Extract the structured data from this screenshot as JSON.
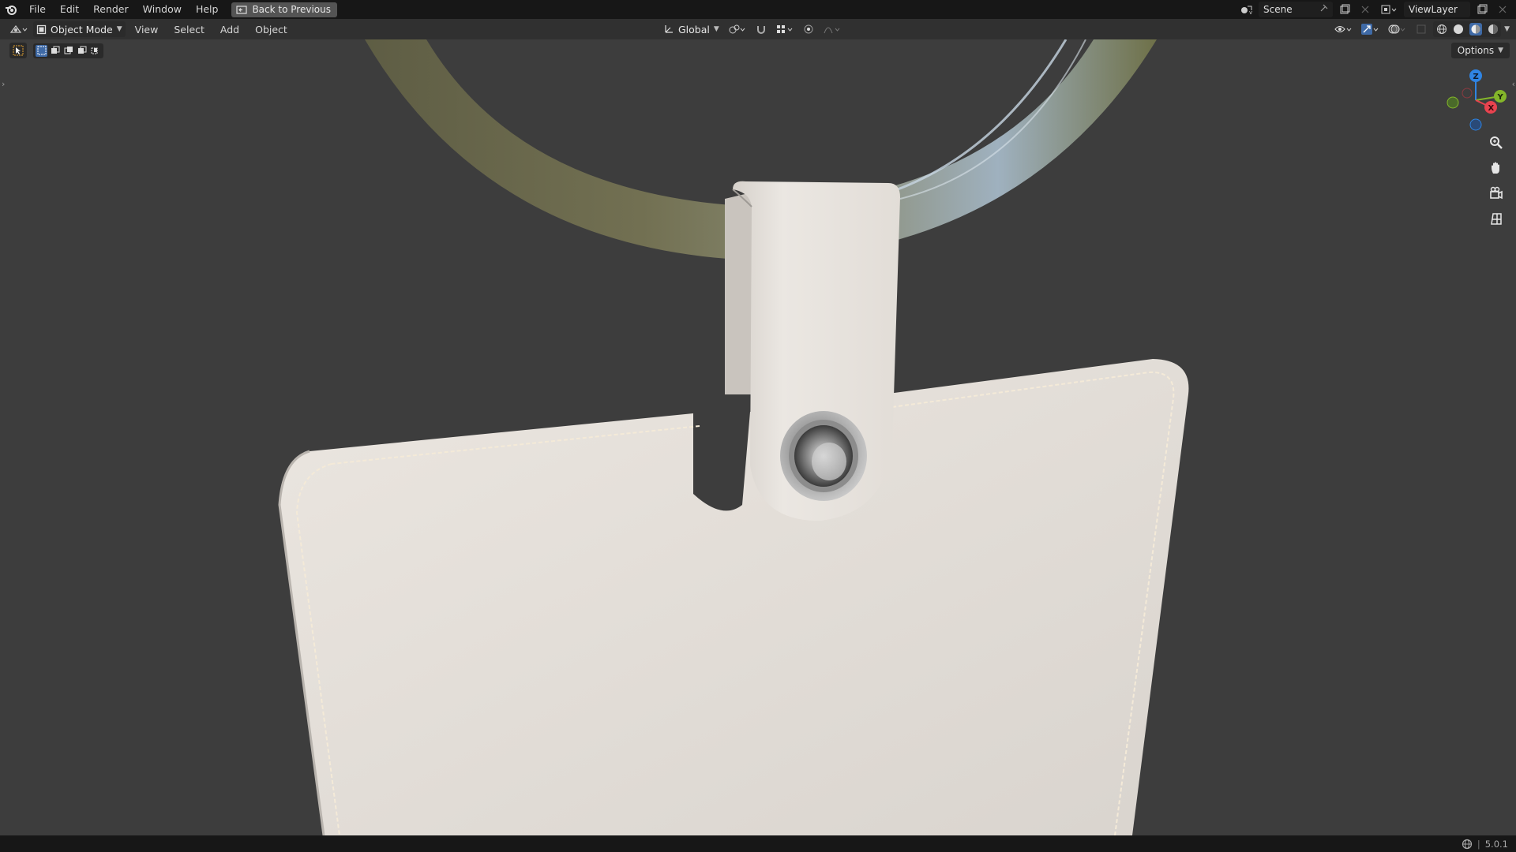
{
  "topbar": {
    "menus": [
      "File",
      "Edit",
      "Render",
      "Window",
      "Help"
    ],
    "back_button": "Back to Previous",
    "scene_name": "Scene",
    "view_layer": "ViewLayer"
  },
  "header": {
    "mode": "Object Mode",
    "menus": [
      "View",
      "Select",
      "Add",
      "Object"
    ],
    "transform_orientation": "Global"
  },
  "viewport": {
    "options_label": "Options",
    "gizmo_axes": {
      "x": "X",
      "y": "Y",
      "z": "Z"
    },
    "colors": {
      "background": "#3d3d3d",
      "ring": "#6c6a50",
      "leather": "#e5e0da",
      "stitch": "#f6ead7",
      "eyelet": "#b9b9b9",
      "axis_x": "#e8434f",
      "axis_y": "#84b62a",
      "axis_z": "#2f84e3"
    }
  },
  "statusbar": {
    "version": "5.0.1"
  },
  "icons": [
    "blender-logo-icon",
    "editor-type-icon",
    "object-mode-icon",
    "select-tool-icon",
    "zoom-icon",
    "hand-pan-icon",
    "camera-icon",
    "grid-icon",
    "globe-icon"
  ]
}
